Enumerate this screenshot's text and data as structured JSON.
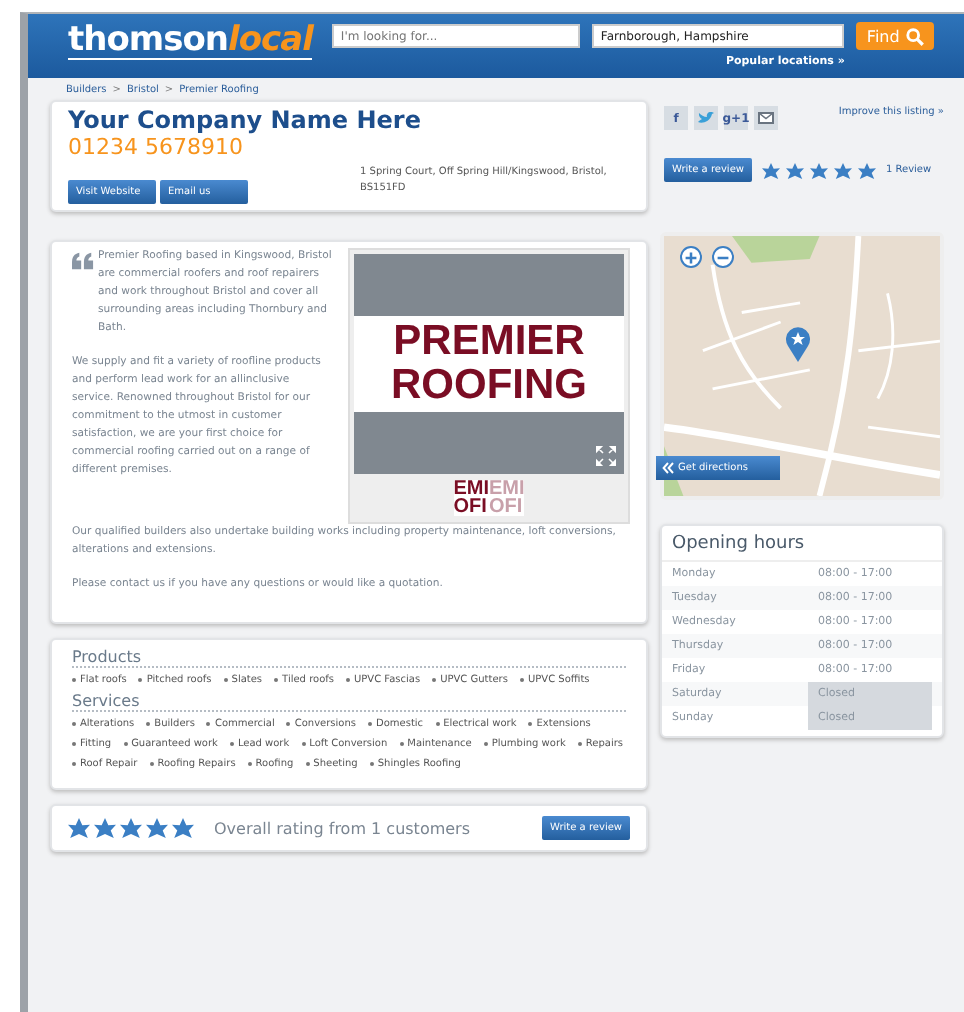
{
  "header": {
    "logo": [
      "thomson",
      "local"
    ],
    "search": {
      "placeholder": "I'm looking for..."
    },
    "location": {
      "value": "Farnborough, Hampshire"
    },
    "find_button": "Find",
    "popular_link": "Popular locations »"
  },
  "breadcrumbs": [
    "Builders",
    "Bristol",
    "Premier Roofing"
  ],
  "breadcrumb_separator": ">",
  "company": {
    "name": "Your Company Name Here",
    "phone": "01234 5678910",
    "address": "1 Spring Court, Off Spring Hill/Kingswood, Bristol, BS151FD",
    "buttons": [
      "Visit Website",
      "Email us"
    ]
  },
  "share": [
    {
      "kind": "text",
      "label": "f"
    },
    {
      "kind": "bird"
    },
    {
      "kind": "text",
      "label": "g+1"
    },
    {
      "kind": "mail"
    }
  ],
  "improve_link": "Improve this listing »",
  "review": {
    "button": "Write a review",
    "stars": 5,
    "count": "1 Review"
  },
  "description": {
    "intro": [
      "Premier Roofing based in Kingswood, Bristol are commercial roofers and roof repairers and work throughout Bristol and cover all surrounding areas including Thornbury and Bath.",
      "We supply and fit a variety of roofline products and perform lead work for an allinclusive service. Renowned throughout Bristol for our commitment to the utmost in customer satisfaction, we are your first choice for commercial roofing carried out on a range of different premises."
    ],
    "more": [
      "Our qualified builders also undertake building works including property maintenance, loft conversions, alterations and extensions.",
      "Please contact us if you have any questions or would like a quotation."
    ]
  },
  "gallery": {
    "main": [
      "PREMIER",
      "ROOFING"
    ],
    "thumbnails": [
      {
        "lines": [
          "EMI",
          "OFI"
        ],
        "selected": true
      },
      {
        "lines": [
          "EMI",
          "OFI"
        ],
        "selected": false
      }
    ]
  },
  "map": {
    "kind": "picture",
    "directions_button": "Get directions"
  },
  "opening_hours": {
    "title": "Opening hours",
    "days": [
      {
        "day": "Monday",
        "hours": "08:00 - 17:00",
        "closed": false
      },
      {
        "day": "Tuesday",
        "hours": "08:00 - 17:00",
        "closed": false
      },
      {
        "day": "Wednesday",
        "hours": "08:00 - 17:00",
        "closed": false
      },
      {
        "day": "Thursday",
        "hours": "08:00 - 17:00",
        "closed": false
      },
      {
        "day": "Friday",
        "hours": "08:00 - 17:00",
        "closed": false
      },
      {
        "day": "Saturday",
        "hours": "Closed",
        "closed": true
      },
      {
        "day": "Sunday",
        "hours": "Closed",
        "closed": true
      }
    ]
  },
  "sections": [
    {
      "title": "Products",
      "items": [
        "Flat roofs",
        "Pitched roofs",
        "Slates",
        "Tiled roofs",
        "UPVC Fascias",
        "UPVC Gutters",
        "UPVC Soffits"
      ]
    },
    {
      "title": "Services",
      "items": [
        "Alterations",
        "Builders",
        "Commercial",
        "Conversions",
        "Domestic",
        "Electrical work",
        "Extensions",
        "Fitting",
        "Guaranteed work",
        "Lead work",
        "Loft Conversion",
        "Maintenance",
        "Plumbing work",
        "Repairs",
        "Roof Repair",
        "Roofing Repairs",
        "Roofing",
        "Sheeting",
        "Shingles Roofing"
      ]
    }
  ],
  "rating": {
    "stars": 5,
    "text": "Overall rating from 1 customers",
    "button": "Write a review"
  }
}
